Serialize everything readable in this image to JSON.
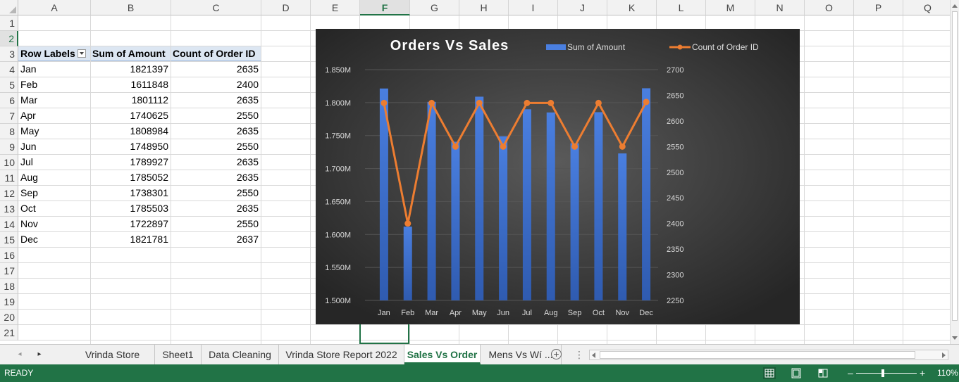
{
  "columns": [
    "A",
    "B",
    "C",
    "D",
    "E",
    "F",
    "G",
    "H",
    "I",
    "J",
    "K",
    "L",
    "M",
    "N",
    "O",
    "P",
    "Q"
  ],
  "rows": [
    "1",
    "2",
    "3",
    "4",
    "5",
    "6",
    "7",
    "8",
    "9",
    "10",
    "11",
    "12",
    "13",
    "14",
    "15",
    "16",
    "17",
    "18",
    "19",
    "20",
    "21"
  ],
  "selected_column": "F",
  "selected_row": "2",
  "pivot": {
    "headers": [
      "Row Labels",
      "Sum of Amount",
      "Count of Order ID"
    ],
    "rows": [
      [
        "Jan",
        "1821397",
        "2635"
      ],
      [
        "Feb",
        "1611848",
        "2400"
      ],
      [
        "Mar",
        "1801112",
        "2635"
      ],
      [
        "Apr",
        "1740625",
        "2550"
      ],
      [
        "May",
        "1808984",
        "2635"
      ],
      [
        "Jun",
        "1748950",
        "2550"
      ],
      [
        "Jul",
        "1789927",
        "2635"
      ],
      [
        "Aug",
        "1785052",
        "2635"
      ],
      [
        "Sep",
        "1738301",
        "2550"
      ],
      [
        "Oct",
        "1785503",
        "2635"
      ],
      [
        "Nov",
        "1722897",
        "2550"
      ],
      [
        "Dec",
        "1821781",
        "2637"
      ]
    ]
  },
  "chart_data": {
    "type": "bar",
    "title": "Orders Vs Sales",
    "categories": [
      "Jan",
      "Feb",
      "Mar",
      "Apr",
      "May",
      "Jun",
      "Jul",
      "Aug",
      "Sep",
      "Oct",
      "Nov",
      "Dec"
    ],
    "series": [
      {
        "name": "Sum of Amount",
        "type": "bar",
        "axis": "left",
        "color": "#4472c4",
        "values": [
          1821397,
          1611848,
          1801112,
          1740625,
          1808984,
          1748950,
          1789927,
          1785052,
          1738301,
          1785503,
          1722897,
          1821781
        ]
      },
      {
        "name": "Count of Order ID",
        "type": "line",
        "axis": "right",
        "color": "#ed7d31",
        "values": [
          2635,
          2400,
          2635,
          2550,
          2635,
          2550,
          2635,
          2635,
          2550,
          2635,
          2550,
          2637
        ]
      }
    ],
    "y_left": {
      "min": 1500000,
      "max": 1850000,
      "ticks": [
        {
          "value": 1500000,
          "label": "1.500M"
        },
        {
          "value": 1550000,
          "label": "1.550M"
        },
        {
          "value": 1600000,
          "label": "1.600M"
        },
        {
          "value": 1650000,
          "label": "1.650M"
        },
        {
          "value": 1700000,
          "label": "1.700M"
        },
        {
          "value": 1750000,
          "label": "1.750M"
        },
        {
          "value": 1800000,
          "label": "1.800M"
        },
        {
          "value": 1850000,
          "label": "1.850M"
        }
      ]
    },
    "y_right": {
      "min": 2250,
      "max": 2700,
      "ticks": [
        {
          "value": 2250,
          "label": "2250"
        },
        {
          "value": 2300,
          "label": "2300"
        },
        {
          "value": 2350,
          "label": "2350"
        },
        {
          "value": 2400,
          "label": "2400"
        },
        {
          "value": 2450,
          "label": "2450"
        },
        {
          "value": 2500,
          "label": "2500"
        },
        {
          "value": 2550,
          "label": "2550"
        },
        {
          "value": 2600,
          "label": "2600"
        },
        {
          "value": 2650,
          "label": "2650"
        },
        {
          "value": 2700,
          "label": "2700"
        }
      ]
    },
    "legend": "top-right",
    "grid": true,
    "background": "#2b2b2b"
  },
  "tabs": [
    {
      "label": "Vrinda Store",
      "active": false
    },
    {
      "label": "Sheet1",
      "active": false
    },
    {
      "label": "Data Cleaning",
      "active": false
    },
    {
      "label": "Vrinda Store Report 2022",
      "active": false
    },
    {
      "label": "Sales Vs Order",
      "active": true
    },
    {
      "label": "Mens Vs Wí ...",
      "active": false
    }
  ],
  "tab_nav_next": "▸",
  "tab_nav_prev": "◂",
  "add_sheet": "+",
  "tab_menu": "⋮",
  "status": {
    "ready": "READY",
    "zoom": "110%",
    "zoom_minus": "–",
    "zoom_plus": "+",
    "view_icons": [
      "normal-view-icon",
      "page-layout-icon",
      "page-break-preview-icon"
    ]
  },
  "colors": {
    "accent": "#217346",
    "pivot_header": "#dce6f2"
  }
}
